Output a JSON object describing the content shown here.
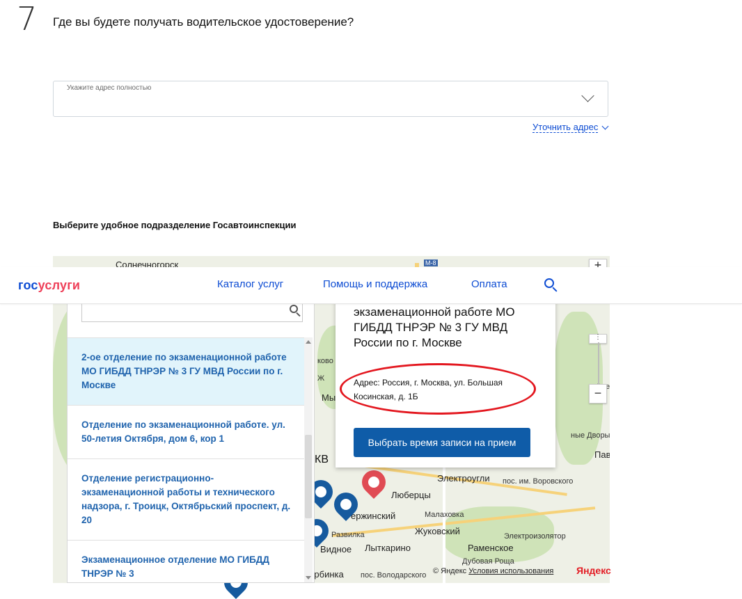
{
  "step": {
    "number": "7",
    "question": "Где вы будете получать водительское удостоверение?"
  },
  "address": {
    "placeholder": "Укажите адрес полностью",
    "value": "",
    "clarify_link": "Уточнить адрес"
  },
  "section_title": "Выберите удобное подразделение Госавтоинспекции",
  "header": {
    "logo_part1": "гос",
    "logo_part2": "услуги",
    "nav": [
      "Каталог услуг",
      "Помощь и поддержка",
      "Оплата"
    ]
  },
  "list_items": [
    "2-ое отделение по экзаменационной работе МО ГИБДД ТНРЭР № 3 ГУ МВД России по г. Москве",
    "Отделение по экзаменационной работе. ул. 50-летия Октября, дом 6, кор 1",
    "Отделение регистрационно-экзаменационной работы и технического надзора, г. Троицк, Октябрьский проспект, д. 20",
    "Экзаменационное отделение МО ГИБДД ТНРЭР № 3"
  ],
  "popup": {
    "name": "экзаменационной работе МО ГИБДД ТНРЭР № 3 ГУ МВД России по г. Москве",
    "address": "Адрес: Россия, г. Москва, ул. Большая Косинская, д. 1Б",
    "button": "Выбрать время записи на прием"
  },
  "map_labels": {
    "solnechnogorsk": "Солнечногорск",
    "m8": "М-8",
    "elektrougli": "Электроугли",
    "pavlovsky": "Павлов",
    "zhukovsky": "Жуковский",
    "ramenskoe": "Раменское",
    "lytkarino": "Лыткарино",
    "vidnoe": "Видное",
    "lyubertsy": "Люберцы",
    "dzerzhinsky": "ержинский",
    "malakhovka": "Малаховка",
    "razvilka": "Развилка",
    "shcherbinka": "Щербинка",
    "volodarsky": "пос. Володарского",
    "dubovaya": "Дубовая Роща",
    "elektroizolyator": "Электроизолятор",
    "vorovskogo": "пос. им. Воровского",
    "elektro": "Электр",
    "dvory": "ные Дворы",
    "kv": "КВ",
    "mo": "Мы",
    "kovo": "ково",
    "zh": "Ж"
  },
  "map_footer": {
    "copyright": "© Яндекс",
    "terms": "Условия использования",
    "brand": "Яндекс"
  },
  "colors": {
    "accent": "#0d4cd3",
    "button": "#0f5ca8",
    "marker_blue": "#165a9e",
    "marker_red": "#e04b54",
    "highlight": "#e3171f"
  }
}
